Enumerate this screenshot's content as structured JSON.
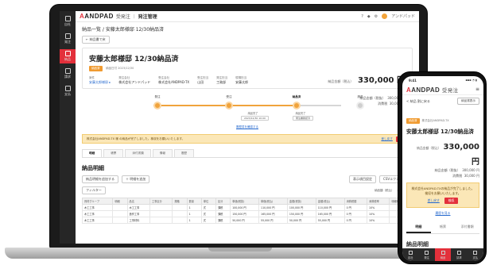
{
  "app": {
    "logo_mark": "A",
    "logo_text": "ANDPAD",
    "module": "受発注",
    "page": "発注管理",
    "user": "アンドパッド"
  },
  "sidebar": {
    "items": [
      {
        "label": "自社"
      },
      {
        "label": "発注"
      },
      {
        "label": "納品",
        "active": true
      },
      {
        "label": "請求"
      },
      {
        "label": "支払"
      }
    ]
  },
  "breadcrumb": "納品一覧 / 安藤太郎様邸 12/30納品済",
  "back_button": "← 納品書で戻",
  "detail": {
    "badge": "納品済",
    "title": "安藤太郎様邸 12/30納品済",
    "sub_meta": "納品日付  2023/12/30",
    "amount_label": "納品金額（税込）",
    "amount": "330,000 円",
    "subtotal_label": "納品金額（税抜）",
    "subtotal": "300,000 円",
    "tax_label": "消費税",
    "tax": "30,000 円",
    "meta": [
      {
        "label": "案件",
        "value": "安藤太郎様邸 ▸",
        "link": true
      },
      {
        "label": "発注会社",
        "value": "株式会社アンドパッド"
      },
      {
        "label": "受注会社",
        "value": "株式会社ANDPAD-TX"
      },
      {
        "label": "受注担当",
        "value": "山田"
      },
      {
        "label": "発注担当",
        "value": "工務部"
      },
      {
        "label": "現場担当",
        "value": "安藤太郎"
      }
    ]
  },
  "progress": {
    "steps": [
      {
        "label": "発注",
        "state": "done"
      },
      {
        "label": "受注",
        "state": "done"
      },
      {
        "label": "納品済",
        "state": "current"
      },
      {
        "label": "請求",
        "state": "pending"
      }
    ],
    "sub_label": "納品完了",
    "sub_date": "2023/12/30 10:00",
    "sub_label2": "納品完了",
    "sub_box": "発注書確認済",
    "history_link": "履歴書を確認する"
  },
  "notice": {
    "text": "株式会社ANDPAD-TX 様 の納品が完了しました。検収をお願いいたします。",
    "link": "差し戻す",
    "button": "検収"
  },
  "tabs": [
    "明細",
    "帳票",
    "添付書類",
    "情報",
    "履歴"
  ],
  "section_title": "納品明細",
  "tools": {
    "left": "納品明細を追加する",
    "left2": "＋ 明細を追加",
    "filter": "フィルター",
    "right1": "表示項目設定",
    "right2": "CSVエクスポート",
    "total_label": "納品額（税込）",
    "total": "330,000円"
  },
  "table": {
    "headers": [
      "資材グループ",
      "明細",
      "品名",
      "工事区分",
      "規格",
      "数量",
      "単位",
      "区分",
      "単価(税抜)",
      "単価(税込)",
      "金額(税抜)",
      "金額(税込)",
      "消費税額",
      "消費税率",
      "明細備考"
    ],
    "rows": [
      [
        "木工工事",
        "",
        "木工工事",
        "",
        "",
        "1",
        "式",
        "課税",
        "100,000 円",
        "110,000 円",
        "100,000 円",
        "110,000 円",
        "0 円",
        "10%",
        ""
      ],
      [
        "木工工事",
        "",
        "造作工事",
        "",
        "",
        "1",
        "式",
        "課税",
        "150,000 円",
        "165,000 円",
        "150,000 円",
        "165,000 円",
        "0 円",
        "10%",
        ""
      ],
      [
        "木工工事",
        "",
        "工事材料",
        "",
        "",
        "1",
        "式",
        "課税",
        "50,000 円",
        "55,000 円",
        "50,000 円",
        "55,000 円",
        "0 円",
        "10%",
        ""
      ]
    ]
  },
  "phone": {
    "time": "9:41",
    "status": "▪▪▪ ◔ ▮",
    "logo_mark": "A",
    "logo_text": "ANDPAD",
    "logo_sub": "受発注",
    "back": "< 納品 割に戻る",
    "top_button": "納品書表示",
    "badge": "納品済",
    "sub": "株式会社ANDPAD-TX",
    "title": "安藤太郎様邸 12/30納品済",
    "amount_label": "納品金額（税込）",
    "amount": "330,000 円",
    "subtotal_label": "納品金額（税抜）",
    "subtotal": "300,000 円",
    "tax_label": "消費税",
    "tax": "30,000 円",
    "notice_text": "株式会社ANDPAD-TXの納品が完了しました。検収をお願いいたします。",
    "notice_link": "差し戻す",
    "notice_button": "検収",
    "history_link": "履歴を見る",
    "tabs": [
      "明細",
      "帳票",
      "添付書類"
    ],
    "section_title": "納品明細",
    "nav": [
      "自社",
      "発注",
      "納品",
      "請求",
      "支払"
    ]
  }
}
